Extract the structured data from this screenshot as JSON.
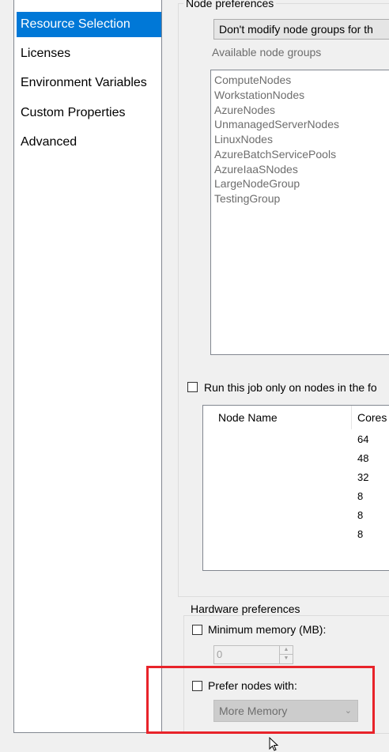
{
  "nav": {
    "items": [
      {
        "label": "Resource Selection",
        "selected": true
      },
      {
        "label": "Licenses",
        "selected": false
      },
      {
        "label": "Environment Variables",
        "selected": false
      },
      {
        "label": "Custom Properties",
        "selected": false
      },
      {
        "label": "Advanced",
        "selected": false
      }
    ]
  },
  "node_prefs": {
    "title": "Node preferences",
    "mode_select": "Don't modify node groups for th",
    "available_label": "Available node groups",
    "groups": [
      "ComputeNodes",
      "WorkstationNodes",
      "AzureNodes",
      "UnmanagedServerNodes",
      "LinuxNodes",
      "AzureBatchServicePools",
      "AzureIaaSNodes",
      "LargeNodeGroup",
      "TestingGroup"
    ],
    "run_only_label": "Run this job only on nodes in the fo",
    "table": {
      "col_node_name": "Node Name",
      "col_cores": "Cores",
      "cores": [
        "64",
        "48",
        "32",
        "8",
        "8",
        "8"
      ]
    }
  },
  "hw_prefs": {
    "title": "Hardware preferences",
    "min_memory_label": "Minimum memory (MB):",
    "min_memory_value": "0",
    "prefer_label": "Prefer nodes with:",
    "prefer_value": "More Memory"
  },
  "colors": {
    "accent": "#0078d7",
    "highlight": "#e8232a"
  }
}
